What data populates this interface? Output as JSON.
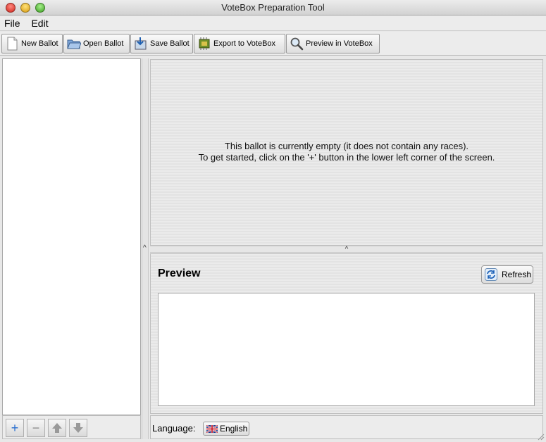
{
  "window": {
    "title": "VoteBox Preparation Tool"
  },
  "menu": {
    "items": [
      "File",
      "Edit"
    ]
  },
  "toolbar": {
    "new_ballot": "New Ballot",
    "open_ballot": "Open Ballot",
    "save_ballot": "Save Ballot",
    "export": "Export to VoteBox",
    "preview": "Preview in VoteBox"
  },
  "editor": {
    "empty_line1": "This ballot is currently empty (it does not contain any races).",
    "empty_line2": "To get started, click on the '+' button in the lower left corner of the screen."
  },
  "preview": {
    "title": "Preview",
    "refresh": "Refresh"
  },
  "language": {
    "label": "Language:",
    "selected": "English"
  },
  "left_controls": {
    "add": "+",
    "remove": "−"
  }
}
